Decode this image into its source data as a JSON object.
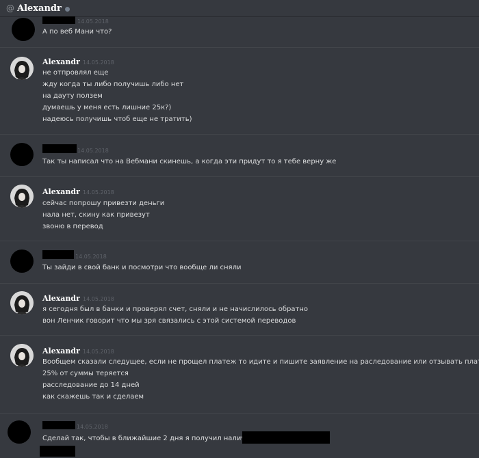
{
  "header": {
    "at_symbol": "@",
    "name": "Alexandr"
  },
  "messages": [
    {
      "author": "",
      "time": "14.05.2018",
      "lines": [
        "А по веб Мани что?"
      ]
    },
    {
      "author": "Alexandr",
      "time": "14.05.2018",
      "lines": [
        "не отпровлял еще",
        "жду когда ты либо получишь либо нет",
        "на дауту ползем",
        "думаешь у меня есть лишние 25к?)",
        "надеюсь получишь чтоб еще не тратить)"
      ]
    },
    {
      "author": "",
      "time": "14.05.2018",
      "lines": [
        "Так ты написал что на Вебмани скинешь, а когда эти придут то я тебе верну же"
      ]
    },
    {
      "author": "Alexandr",
      "time": "14.05.2018",
      "lines": [
        "сейчас попрошу привезти деньги",
        "нала нет, скину как привезут",
        "звоню в перевод"
      ]
    },
    {
      "author": "",
      "time": "14.05.2018",
      "lines": [
        "Ты зайди в свой банк и посмотри что вообще ли сняли"
      ]
    },
    {
      "author": "Alexandr",
      "time": "14.05.2018",
      "lines": [
        "я сегодня был в банки и проверял счет, сняли и не начислилось обратно",
        "вон Ленчик говорит что мы зря связались с этой системой переводов"
      ]
    },
    {
      "author": "Alexandr",
      "time": "14.05.2018",
      "lines": [
        "Вообщем сказали следущее, если не прощел платеж то идите и пишите заявление на раследование или отзывать платеж",
        "25% от суммы теряется",
        "расследование до 14 дней",
        "как скажешь так и сделаем"
      ]
    },
    {
      "author": "",
      "time": "14.05.2018",
      "lines": [
        "Сделай так, чтобы в ближайшие 2 дня я получил наличку,"
      ]
    }
  ]
}
